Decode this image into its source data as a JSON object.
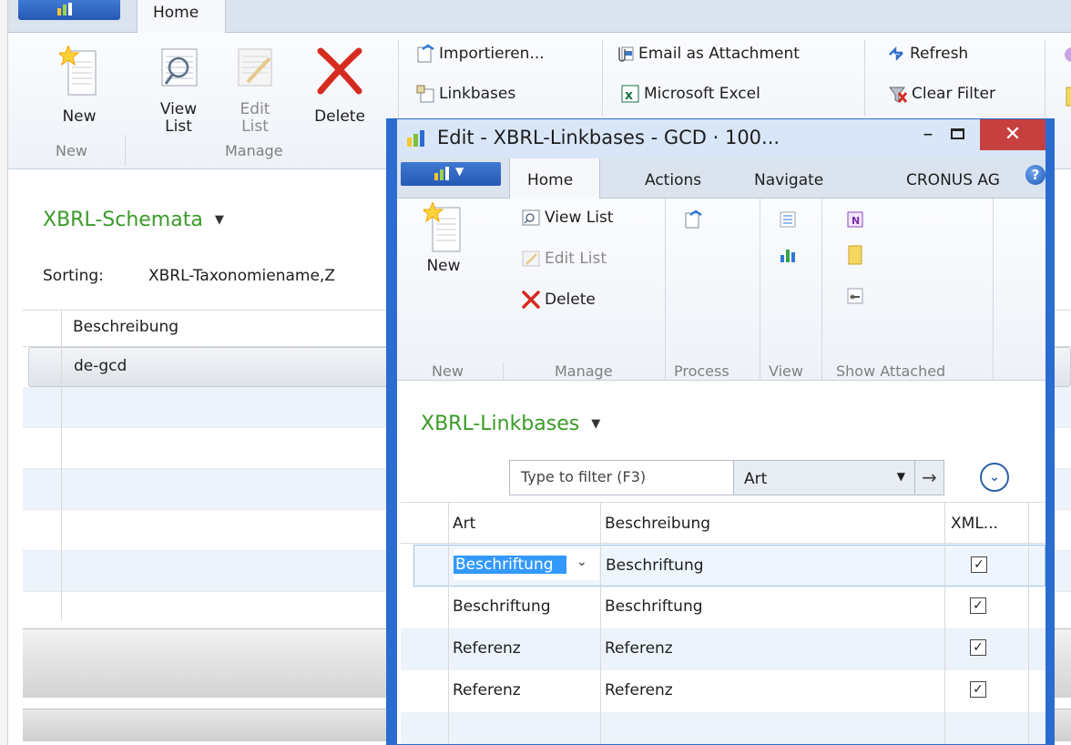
{
  "background": {
    "tabs": {
      "home": "Home"
    },
    "ribbon": {
      "new": "New",
      "view_list": "View List",
      "edit_list": "Edit List",
      "delete": "Delete",
      "importieren": "Importieren...",
      "linkbases": "Linkbases",
      "email_attachment": "Email as Attachment",
      "microsoft_excel": "Microsoft Excel",
      "refresh": "Refresh",
      "clear_filter": "Clear Filter",
      "group_new": "New",
      "group_manage": "Manage"
    },
    "page_title": "XBRL-Schemata",
    "sorting_label": "Sorting:",
    "sorting_value": "XBRL-Taxonomiename,Z",
    "grid": {
      "header": "Beschreibung",
      "rows": [
        "de-gcd"
      ]
    }
  },
  "dialog": {
    "title": "Edit - XBRL-Linkbases - GCD · 100...",
    "controls": {
      "minimize": "–",
      "close": "✕"
    },
    "tabs": {
      "home": "Home",
      "actions": "Actions",
      "navigate": "Navigate",
      "company": "CRONUS AG"
    },
    "ribbon": {
      "new": "New",
      "view_list": "View List",
      "edit_list": "Edit List",
      "delete": "Delete",
      "group_new": "New",
      "group_manage": "Manage",
      "group_process": "Process",
      "group_view": "View",
      "group_show_attached": "Show Attached"
    },
    "page_title": "XBRL-Linkbases",
    "filter": {
      "placeholder": "Type to filter (F3)",
      "field": "Art"
    },
    "grid": {
      "columns": [
        "Art",
        "Beschreibung",
        "XML..."
      ],
      "editing_value": "Beschriftung",
      "rows": [
        {
          "art": "Beschriftung",
          "beschreibung": "Beschriftung",
          "xml": true
        },
        {
          "art": "Beschriftung",
          "beschreibung": "Beschriftung",
          "xml": true
        },
        {
          "art": "Referenz",
          "beschreibung": "Referenz",
          "xml": true
        },
        {
          "art": "Referenz",
          "beschreibung": "Referenz",
          "xml": true
        }
      ]
    }
  },
  "colors": {
    "accent_blue": "#2b6cd0",
    "title_green": "#3a9b28",
    "close_red": "#c74040",
    "selection_blue": "#3399ff"
  }
}
